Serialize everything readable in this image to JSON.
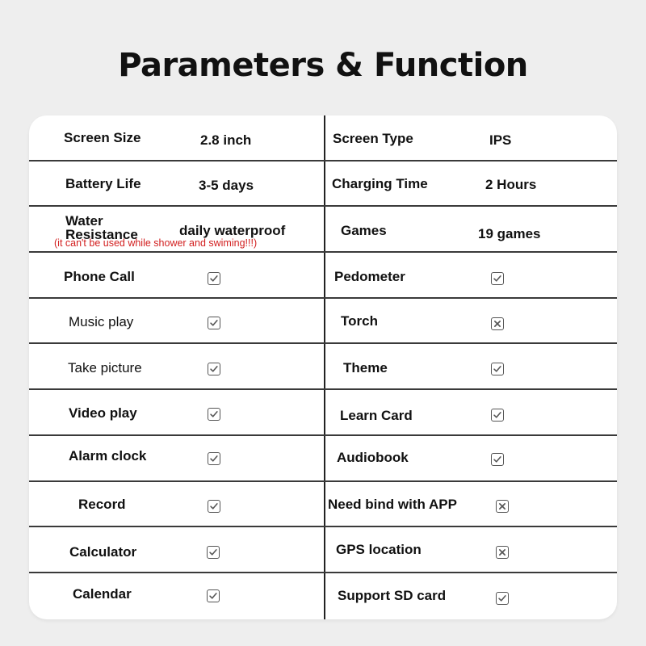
{
  "title": "Parameters & Function",
  "colors": {
    "note": "#d21e1e",
    "background": "#eeeeee",
    "card": "#ffffff"
  },
  "specs": [
    {
      "left": {
        "label": "Screen Size",
        "value": "2.8 inch"
      },
      "right": {
        "label": "Screen Type",
        "value": "IPS"
      }
    },
    {
      "left": {
        "label": "Battery Life",
        "value": "3-5 days"
      },
      "right": {
        "label": "Charging Time",
        "value": "2 Hours"
      }
    },
    {
      "left": {
        "label_line1": "Water",
        "label_line2": "Resistance",
        "value": "daily waterproof",
        "note": "(it can't be used while shower and swiming!!!)"
      },
      "right": {
        "label": "Games",
        "value": "19 games"
      }
    }
  ],
  "features": [
    {
      "left": {
        "label": "Phone Call",
        "supported": true,
        "icon": "checkbox-checked"
      },
      "right": {
        "label": "Pedometer",
        "supported": true,
        "icon": "checkbox-checked"
      }
    },
    {
      "left": {
        "label": "Music play",
        "supported": true,
        "icon": "checkbox-checked"
      },
      "right": {
        "label": "Torch",
        "supported": false,
        "icon": "checkbox-crossed"
      }
    },
    {
      "left": {
        "label": "Take picture",
        "supported": true,
        "icon": "checkbox-checked"
      },
      "right": {
        "label": "Theme",
        "supported": true,
        "icon": "checkbox-checked"
      }
    },
    {
      "left": {
        "label": "Video play",
        "supported": true,
        "icon": "checkbox-checked"
      },
      "right": {
        "label": "Learn Card",
        "supported": true,
        "icon": "checkbox-checked"
      }
    },
    {
      "left": {
        "label": "Alarm clock",
        "supported": true,
        "icon": "checkbox-checked"
      },
      "right": {
        "label": "Audiobook",
        "supported": true,
        "icon": "checkbox-checked"
      }
    },
    {
      "left": {
        "label": "Record",
        "supported": true,
        "icon": "checkbox-checked"
      },
      "right": {
        "label": "Need bind with APP",
        "supported": false,
        "icon": "checkbox-crossed"
      }
    },
    {
      "left": {
        "label": "Calculator",
        "supported": true,
        "icon": "checkbox-checked"
      },
      "right": {
        "label": "GPS location",
        "supported": false,
        "icon": "checkbox-crossed"
      }
    },
    {
      "left": {
        "label": "Calendar",
        "supported": true,
        "icon": "checkbox-checked"
      },
      "right": {
        "label": "Support SD card",
        "supported": true,
        "icon": "checkbox-checked"
      }
    }
  ]
}
